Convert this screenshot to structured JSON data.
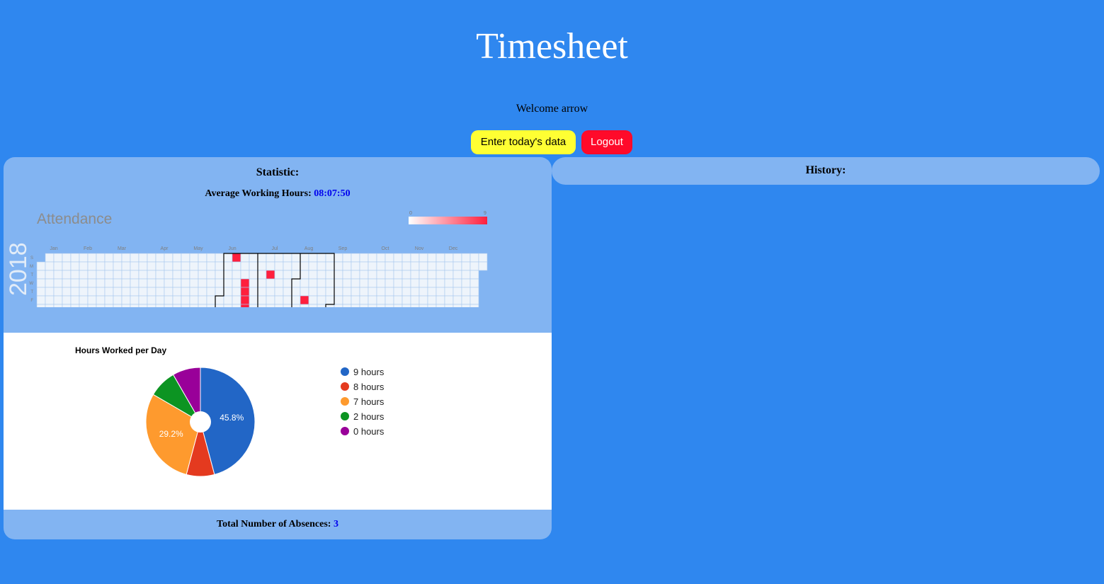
{
  "header": {
    "title": "Timesheet",
    "welcome": "Welcome arrow"
  },
  "actions": {
    "enter_label": "Enter today's data",
    "logout_label": "Logout"
  },
  "statistic": {
    "title": "Statistic:",
    "avg_label": "Average Working Hours:",
    "avg_value": "08:07:50",
    "absence_label": "Total Number of Absences:",
    "absence_value": "3"
  },
  "history": {
    "title": "History:"
  },
  "attendance": {
    "title": "Attendance",
    "year": "2018",
    "months": [
      "Jan",
      "Feb",
      "Mar",
      "Apr",
      "May",
      "Jun",
      "Jul",
      "Aug",
      "Sep",
      "Oct",
      "Nov",
      "Dec"
    ],
    "weekdays": [
      "S",
      "M",
      "T",
      "W",
      "T",
      "F",
      "S"
    ],
    "scale_min": "0",
    "scale_max": "9",
    "colors": {
      "empty": "#eef4fb",
      "grid": "#a9c8ee",
      "high": "#ff1f3d",
      "outline": "#000000"
    },
    "filled_dates": [
      "2018-06-10",
      "2018-06-20",
      "2018-06-21",
      "2018-06-22",
      "2018-06-23",
      "2018-07-10",
      "2018-08-10"
    ]
  },
  "chart_data": {
    "type": "pie",
    "title": "Hours Worked per Day",
    "categories": [
      "9 hours",
      "8 hours",
      "7 hours",
      "2 hours",
      "0 hours"
    ],
    "values": [
      45.8,
      8.3,
      29.2,
      8.3,
      8.3
    ],
    "colors": [
      "#2266c6",
      "#e43a1f",
      "#fe9a2e",
      "#0c9422",
      "#990099"
    ],
    "data_labels": [
      "45.8%",
      "",
      "29.2%",
      "",
      ""
    ],
    "legend": "right",
    "hole": true
  }
}
